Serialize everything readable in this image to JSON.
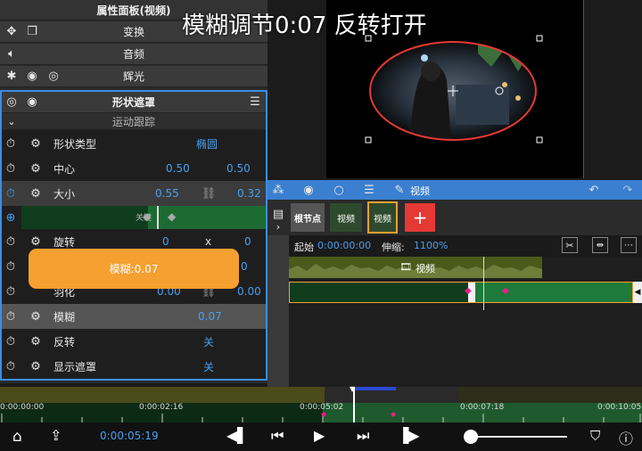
{
  "overlay_caption": "模糊调节0:07  反转打开",
  "panel": {
    "title": "属性面板(视频)",
    "transform": "变换",
    "audio": "音频",
    "glow": "辉光",
    "shape_mask": "形状遮罩",
    "motion_track": "运动跟踪",
    "rows": {
      "shape_type_label": "形状类型",
      "shape_type_value": "椭圆",
      "center_label": "中心",
      "center_x": "0.50",
      "center_y": "0.50",
      "size_label": "大小",
      "size_x": "0.55",
      "size_y": "0.32",
      "rotate_label": "旋转",
      "rotate_a": "0",
      "rotate_b": "x",
      "rotate_c": "0",
      "row5_a": "0",
      "row5_b": "0",
      "feather_label": "羽化",
      "feather_a": "0.00",
      "feather_b": "0.00",
      "blur_label": "模糊",
      "blur_value": "0.07",
      "invert_label": "反转",
      "invert_value": "关",
      "show_mask_label": "显示遮罩",
      "show_mask_value": "关"
    },
    "keyframe_text": "关键"
  },
  "tooltip": "模糊:0.07",
  "timeline": {
    "toolbar_label": "视频",
    "root_node": "根节点",
    "tab_video1": "视频",
    "tab_video2": "视频",
    "start_label": "起始",
    "start_value": "0:00:00:00",
    "stretch_label": "伸缩:",
    "stretch_value": "1100%",
    "clip_label": "视频"
  },
  "ruler": {
    "t0": "0:00:00:00",
    "t1": "0:00:02:16",
    "t2": "0:00:05:02",
    "t3": "0:00:07:18",
    "t4": "0:00:10:05"
  },
  "transport": {
    "current_time": "0:00:05:19"
  },
  "colors": {
    "accent": "#4a9ff0",
    "orange": "#f5a030",
    "green": "#1e7a3a",
    "red": "#e53935"
  }
}
